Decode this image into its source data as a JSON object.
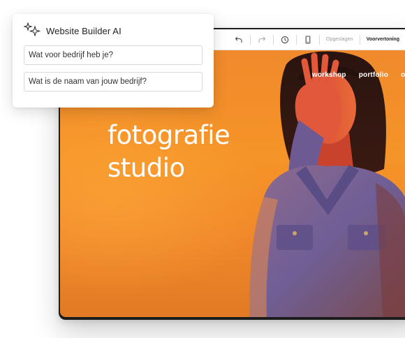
{
  "colors": {
    "accent": "#116dff",
    "site_background": "#f28d2a",
    "frame": "#1d1d1d"
  },
  "editor": {
    "toolbar": {
      "icons": [
        "undo-icon",
        "redo-icon",
        "history-icon",
        "mobile-icon"
      ],
      "save_status": "Opgeslagen",
      "preview_label": "Voorvertoning"
    },
    "site": {
      "nav": [
        "workshop",
        "portfolio",
        "over"
      ],
      "heading_line1": "fotografie",
      "heading_line2": "studio"
    }
  },
  "ai_panel": {
    "icon": "sparkle-icon",
    "title": "Website Builder AI",
    "question1_placeholder": "Wat voor bedrijf heb je?",
    "question2_placeholder": "Wat is de naam van jouw bedrijf?"
  }
}
